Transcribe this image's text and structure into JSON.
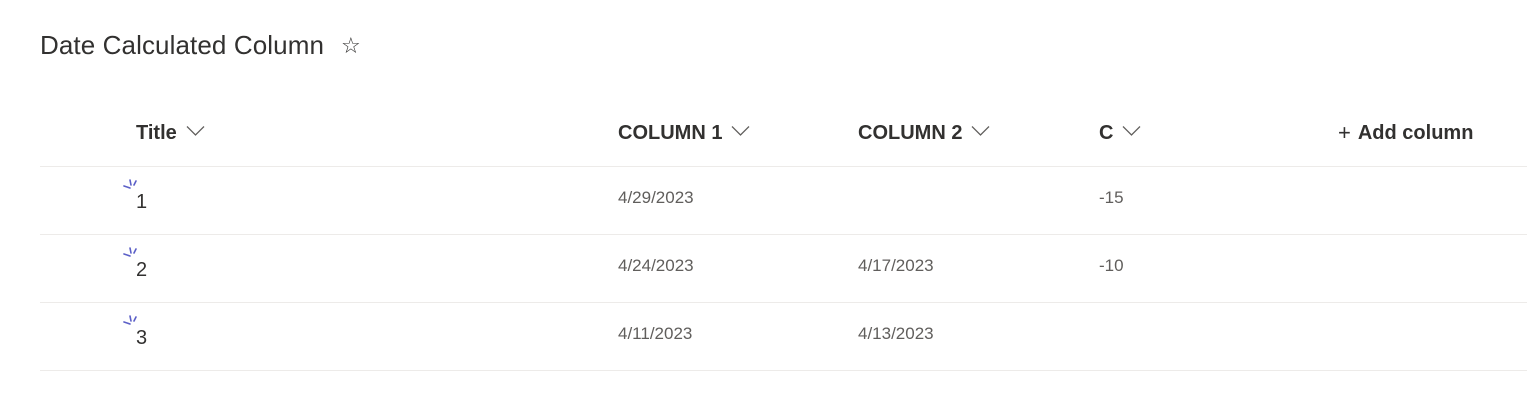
{
  "page": {
    "title": "Date Calculated Column",
    "favorite_icon": "star-outline-icon"
  },
  "columns": [
    {
      "label": "Title"
    },
    {
      "label": "COLUMN 1"
    },
    {
      "label": "COLUMN 2"
    },
    {
      "label": "C"
    }
  ],
  "add_column": {
    "icon": "plus-icon",
    "label": "Add column"
  },
  "rows": [
    {
      "title": "1",
      "column1": "4/29/2023",
      "column2": "",
      "c": "-15",
      "new_indicator": "new-item-icon"
    },
    {
      "title": "2",
      "column1": "4/24/2023",
      "column2": "4/17/2023",
      "c": "-10",
      "new_indicator": "new-item-icon"
    },
    {
      "title": "3",
      "column1": "4/11/2023",
      "column2": "4/13/2023",
      "c": "",
      "new_indicator": "new-item-icon"
    }
  ],
  "colors": {
    "text_primary": "#323130",
    "text_secondary": "#605e5c",
    "divider": "#edebe9",
    "new_indicator": "#5b5fc7"
  }
}
